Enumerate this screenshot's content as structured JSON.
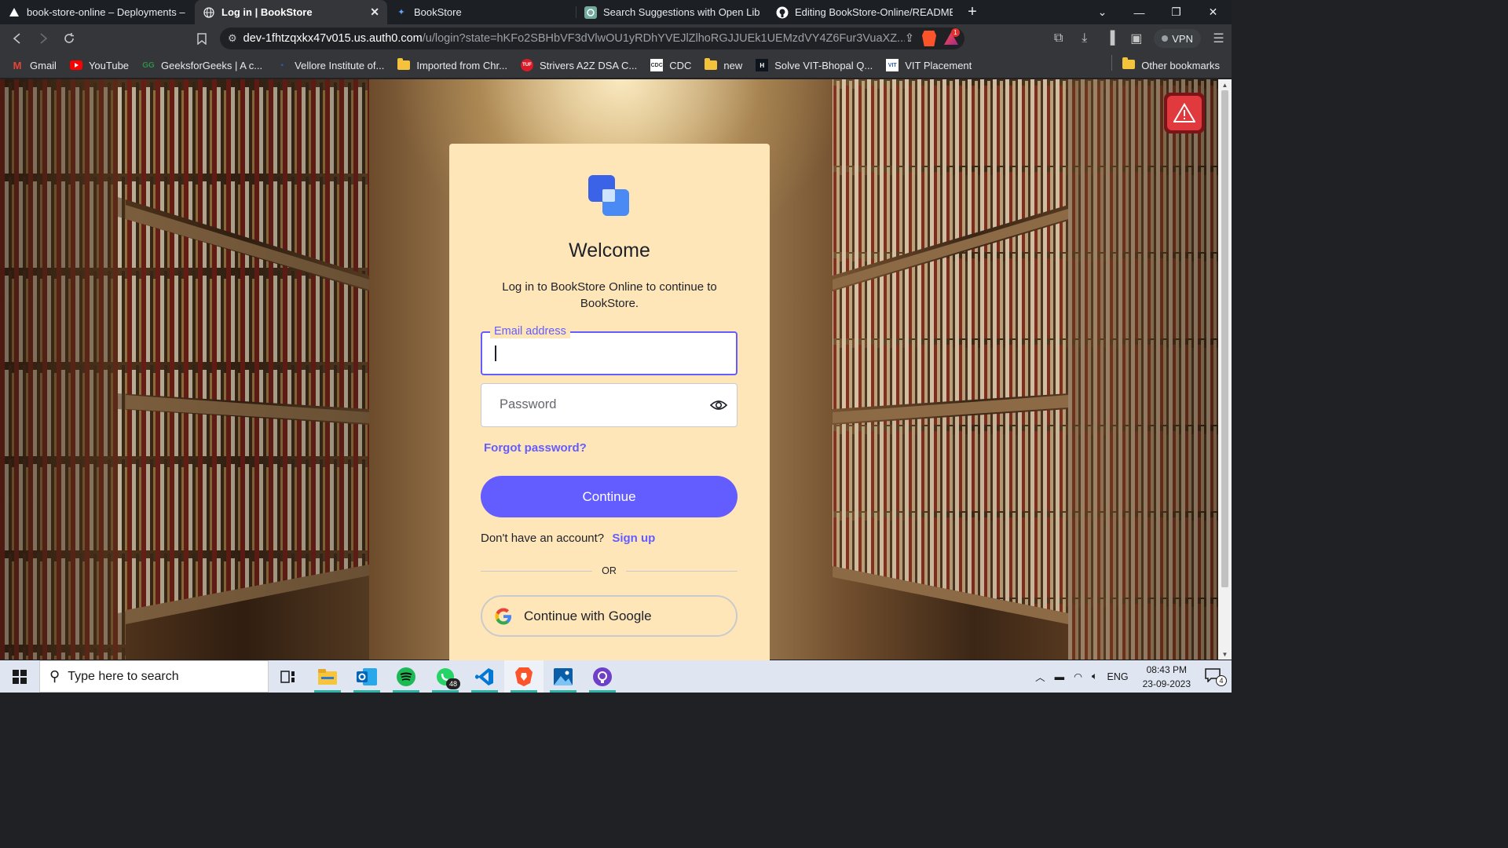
{
  "tabs": [
    {
      "title": "book-store-online – Deployments – Ve",
      "icon": "vercel-icon",
      "active": false
    },
    {
      "title": "Log in | BookStore",
      "icon": "globe-icon",
      "active": true
    },
    {
      "title": "BookStore",
      "icon": "bookstore-icon",
      "active": false
    },
    {
      "title": "Search Suggestions with Open Library",
      "icon": "chatgpt-icon",
      "active": false
    },
    {
      "title": "Editing BookStore-Online/README.md",
      "icon": "github-icon",
      "active": false
    }
  ],
  "address_bar": {
    "host": "dev-1fhtzqxkx47v015.us.auth0.com",
    "path": "/u/login?state=hKFo2SBHbVF3dVlwOU1yRDhYVEJlZlhoRGJJUEk1UEMzdVY4Z6Fur3VuaXZ..."
  },
  "rewards_badge": "1",
  "vpn_label": "VPN",
  "bookmarks": [
    {
      "label": "Gmail",
      "icon": "gmail-icon"
    },
    {
      "label": "YouTube",
      "icon": "youtube-icon"
    },
    {
      "label": "GeeksforGeeks | A c...",
      "icon": "geeksforgeeks-icon"
    },
    {
      "label": "Vellore Institute of...",
      "icon": "vit-icon"
    },
    {
      "label": "Imported from Chr...",
      "icon": "folder-icon"
    },
    {
      "label": "Strivers A2Z DSA C...",
      "icon": "tuf-icon"
    },
    {
      "label": "CDC",
      "icon": "cdc-icon"
    },
    {
      "label": "new",
      "icon": "folder-icon"
    },
    {
      "label": "Solve VIT-Bhopal Q...",
      "icon": "hackerrank-icon"
    },
    {
      "label": "VIT Placement",
      "icon": "vit-placement-icon"
    }
  ],
  "other_bookmarks": "Other bookmarks",
  "login": {
    "title": "Welcome",
    "subtitle": "Log in to BookStore Online to continue to BookStore.",
    "email_label": "Email address",
    "email_value": "",
    "password_placeholder": "Password",
    "forgot": "Forgot password?",
    "continue": "Continue",
    "no_account": "Don't have an account?",
    "signup": "Sign up",
    "or": "OR",
    "google": "Continue with Google"
  },
  "taskbar": {
    "search_placeholder": "Type here to search",
    "whatsapp_badge": "48",
    "language": "ENG",
    "time": "08:43 PM",
    "date": "23-09-2023",
    "notifications": "4"
  },
  "colors": {
    "accent": "#635dff",
    "card_bg": "#ffe6b8"
  }
}
